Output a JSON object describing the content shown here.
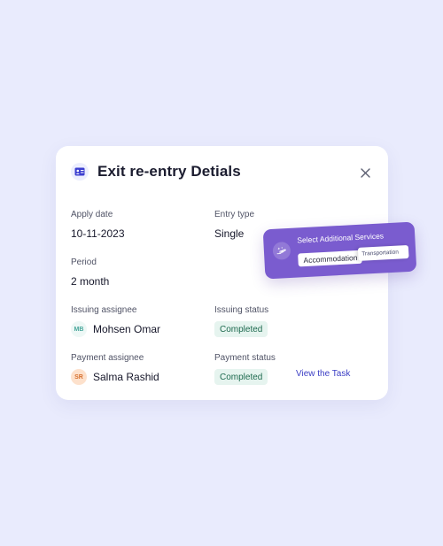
{
  "dialog": {
    "title": "Exit re-entry Detials",
    "icon": "id-card-icon",
    "close_icon": "close-icon"
  },
  "fields": {
    "apply_date": {
      "label": "Apply date",
      "value": "10-11-2023"
    },
    "entry_type": {
      "label": "Entry type",
      "value": "Single"
    },
    "period": {
      "label": "Period",
      "value": "2 month"
    },
    "issuing_assignee": {
      "label": "Issuing assignee",
      "initials": "MB",
      "name": "Mohsen Omar"
    },
    "issuing_status": {
      "label": "Issuing status",
      "value": "Completed"
    },
    "payment_assignee": {
      "label": "Payment assignee",
      "initials": "SR",
      "name": "Salma Rashid"
    },
    "payment_status": {
      "label": "Payment status",
      "value": "Completed"
    }
  },
  "actions": {
    "view_task": "View the Task"
  },
  "services_popup": {
    "title": "Select Additional Services",
    "icon": "hand-sparkle-icon",
    "options": [
      "Accommodation",
      "Transportation"
    ]
  },
  "colors": {
    "background": "#e9ebfd",
    "card": "#ffffff",
    "accent": "#3b3ec4",
    "popup": "#7a5ccf",
    "badge_bg": "#e6f4ef",
    "badge_text": "#1e6a4f"
  }
}
